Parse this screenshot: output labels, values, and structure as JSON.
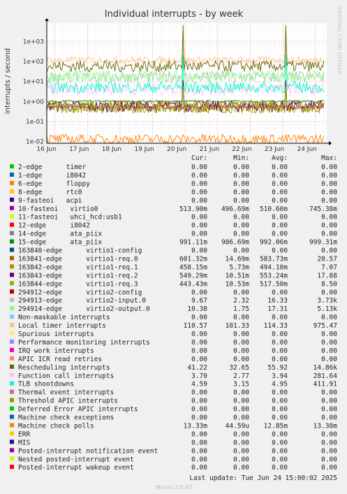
{
  "colors": {
    "background": "#f0f0f0",
    "plot_background": "#ffffff",
    "grid_major": "#f0a0a0",
    "grid_minor": "#d8d8d8",
    "axis": "#000000",
    "text": "#000000",
    "side_label": "#cccccc",
    "footer": "#bbbbbb"
  },
  "chart_data": {
    "type": "line",
    "title": "Individual interrupts - by week",
    "ylabel": "interrupts / second",
    "xlabel": "",
    "yscale": "log",
    "ylim": [
      0.008,
      8000
    ],
    "y_ticks": [
      {
        "value": 1000,
        "label": "1e+03"
      },
      {
        "value": 100,
        "label": "1e+02"
      },
      {
        "value": 10,
        "label": "1e+01"
      },
      {
        "value": 1,
        "label": "1e+00"
      },
      {
        "value": 0.1,
        "label": "1e-01"
      },
      {
        "value": 0.01,
        "label": "1e-02"
      }
    ],
    "x_ticks": [
      "16 Jun",
      "17 Jun",
      "18 Jun",
      "19 Jun",
      "20 Jun",
      "21 Jun",
      "22 Jun",
      "23 Jun",
      "24 Jun"
    ],
    "x_range_days": [
      0,
      8.6
    ],
    "grid": true,
    "side_label": "RRDTOOL / TOBI OETIKER",
    "legend_header": [
      "Cur:",
      "Min:",
      "Avg:",
      "Max:"
    ],
    "series": [
      {
        "name": "2-edge      timer",
        "color": "#00cc00",
        "cur": "0.00",
        "min": "0.00",
        "avg": "0.00",
        "max": "0.00"
      },
      {
        "name": "1-edge      i8042",
        "color": "#0066b3",
        "cur": "0.00",
        "min": "0.00",
        "avg": "0.00",
        "max": "0.00"
      },
      {
        "name": "6-edge      floppy",
        "color": "#ff8000",
        "cur": "0.00",
        "min": "0.00",
        "avg": "0.00",
        "max": "0.00"
      },
      {
        "name": "8-edge      rtc0",
        "color": "#ffcc00",
        "cur": "0.00",
        "min": "0.00",
        "avg": "0.00",
        "max": "0.00"
      },
      {
        "name": "9-fasteoi   acpi",
        "color": "#330099",
        "cur": "0.00",
        "min": "0.00",
        "avg": "0.00",
        "max": "0.00"
      },
      {
        "name": "10-fasteoi   virtio0",
        "color": "#990099",
        "cur": "513.90m",
        "min": "496.69m",
        "avg": "510.60m",
        "max": "745.38m"
      },
      {
        "name": "11-fasteoi   uhci_hcd:usb1",
        "color": "#ccff00",
        "cur": "0.00",
        "min": "0.00",
        "avg": "0.00",
        "max": "0.00"
      },
      {
        "name": "12-edge      i8042",
        "color": "#ff0000",
        "cur": "0.00",
        "min": "0.00",
        "avg": "0.00",
        "max": "0.00"
      },
      {
        "name": "14-edge      ata_piix",
        "color": "#808080",
        "cur": "0.00",
        "min": "0.00",
        "avg": "0.00",
        "max": "0.00"
      },
      {
        "name": "15-edge      ata_piix",
        "color": "#008f00",
        "cur": "991.11m",
        "min": "986.69m",
        "avg": "992.06m",
        "max": "999.31m"
      },
      {
        "name": "163840-edge      virtio1-config",
        "color": "#00487d",
        "cur": "0.00",
        "min": "0.00",
        "avg": "0.00",
        "max": "0.00"
      },
      {
        "name": "163841-edge      virtio1-req.0",
        "color": "#b35a00",
        "cur": "601.32m",
        "min": "14.69m",
        "avg": "583.73m",
        "max": "20.57"
      },
      {
        "name": "163842-edge      virtio1-req.1",
        "color": "#b38f00",
        "cur": "458.15m",
        "min": "5.73m",
        "avg": "494.10m",
        "max": "7.07"
      },
      {
        "name": "163843-edge      virtio1-req.2",
        "color": "#6b006b",
        "cur": "549.29m",
        "min": "10.51m",
        "avg": "553.24m",
        "max": "17.88"
      },
      {
        "name": "163844-edge      virtio1-req.3",
        "color": "#8fb300",
        "cur": "443.43m",
        "min": "10.53m",
        "avg": "517.50m",
        "max": "8.50"
      },
      {
        "name": "294912-edge      virtio2-config",
        "color": "#b30000",
        "cur": "0.00",
        "min": "0.00",
        "avg": "0.00",
        "max": "0.00"
      },
      {
        "name": "294913-edge      virtio2-input.0",
        "color": "#bebebe",
        "cur": "9.67",
        "min": "2.32",
        "avg": "16.33",
        "max": "3.73k"
      },
      {
        "name": "294914-edge      virtio2-output.0",
        "color": "#80ff80",
        "cur": "10.38",
        "min": "1.75",
        "avg": "17.31",
        "max": "5.13k"
      },
      {
        "name": "Non-maskable interrupts",
        "color": "#80c9ff",
        "cur": "0.00",
        "min": "0.00",
        "avg": "0.00",
        "max": "0.00"
      },
      {
        "name": "Local timer interrupts",
        "color": "#ffc080",
        "cur": "110.57",
        "min": "101.33",
        "avg": "114.33",
        "max": "975.47"
      },
      {
        "name": "Spurious interrupts",
        "color": "#ffe680",
        "cur": "0.00",
        "min": "0.00",
        "avg": "0.00",
        "max": "0.00"
      },
      {
        "name": "Performance monitoring interrupts",
        "color": "#aa80ff",
        "cur": "0.00",
        "min": "0.00",
        "avg": "0.00",
        "max": "0.00"
      },
      {
        "name": "IRQ work interrupts",
        "color": "#ee00cc",
        "cur": "0.00",
        "min": "0.00",
        "avg": "0.00",
        "max": "0.00"
      },
      {
        "name": "APIC ICR read retries",
        "color": "#ff8080",
        "cur": "0.00",
        "min": "0.00",
        "avg": "0.00",
        "max": "0.00"
      },
      {
        "name": "Rescheduling interrupts",
        "color": "#666600",
        "cur": "41.22",
        "min": "32.65",
        "avg": "55.92",
        "max": "14.86k"
      },
      {
        "name": "Function call interrupts",
        "color": "#ffbfff",
        "cur": "3.70",
        "min": "2.77",
        "avg": "3.94",
        "max": "281.64"
      },
      {
        "name": "TLB shootdowns",
        "color": "#00ffcc",
        "cur": "4.59",
        "min": "3.15",
        "avg": "4.95",
        "max": "411.91"
      },
      {
        "name": "Thermal event interrupts",
        "color": "#cc6699",
        "cur": "0.00",
        "min": "0.00",
        "avg": "0.00",
        "max": "0.00"
      },
      {
        "name": "Threshold APIC interrupts",
        "color": "#999900",
        "cur": "0.00",
        "min": "0.00",
        "avg": "0.00",
        "max": "0.00"
      },
      {
        "name": "Deferred Error APIC interrupts",
        "color": "#00cc00",
        "cur": "0.00",
        "min": "0.00",
        "avg": "0.00",
        "max": "0.00"
      },
      {
        "name": "Machine check exceptions",
        "color": "#0066b3",
        "cur": "0.00",
        "min": "0.00",
        "avg": "0.00",
        "max": "0.00"
      },
      {
        "name": "Machine check polls",
        "color": "#ff8000",
        "cur": "13.33m",
        "min": "44.59u",
        "avg": "12.85m",
        "max": "13.38m"
      },
      {
        "name": "ERR",
        "color": "#ffcc00",
        "cur": "0.00",
        "min": "0.00",
        "avg": "0.00",
        "max": "0.00"
      },
      {
        "name": "MIS",
        "color": "#330099",
        "cur": "0.00",
        "min": "0.00",
        "avg": "0.00",
        "max": "0.00"
      },
      {
        "name": "Posted-interrupt notification event",
        "color": "#990099",
        "cur": "0.00",
        "min": "0.00",
        "avg": "0.00",
        "max": "0.00"
      },
      {
        "name": "Nested posted-interrupt event",
        "color": "#ccff00",
        "cur": "0.00",
        "min": "0.00",
        "avg": "0.00",
        "max": "0.00"
      },
      {
        "name": "Posted-interrupt wakeup event",
        "color": "#ff0000",
        "cur": "0.00",
        "min": "0.00",
        "avg": "0.00",
        "max": "0.00"
      }
    ],
    "last_update": "Last update: Tue Jun 24 15:00:02 2025",
    "footer": "Munin 2.0.67"
  }
}
